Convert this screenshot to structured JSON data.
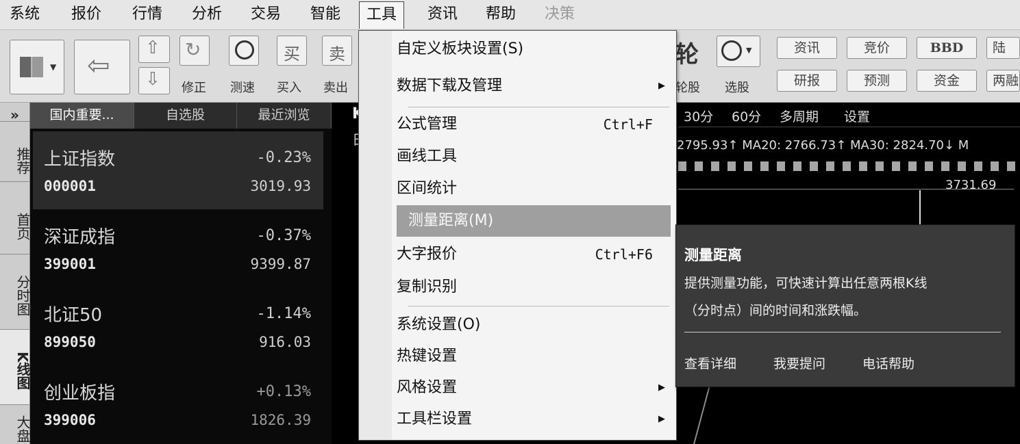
{
  "menubar": {
    "items": [
      {
        "label": "系统",
        "state": "normal"
      },
      {
        "label": "报价",
        "state": "normal"
      },
      {
        "label": "行情",
        "state": "normal"
      },
      {
        "label": "分析",
        "state": "normal"
      },
      {
        "label": "交易",
        "state": "normal"
      },
      {
        "label": "智能",
        "state": "normal"
      },
      {
        "label": "工具",
        "state": "active"
      },
      {
        "label": "资讯",
        "state": "normal"
      },
      {
        "label": "帮助",
        "state": "normal"
      },
      {
        "label": "决策",
        "state": "disabled"
      }
    ]
  },
  "toolbar": {
    "buttons": [
      {
        "label": "修正",
        "icon": "refresh-icon"
      },
      {
        "label": "测速",
        "icon": "clock-icon"
      },
      {
        "label": "买入",
        "icon_text": "买"
      },
      {
        "label": "卖出",
        "icon_text": "卖"
      },
      {
        "label": "轮股",
        "icon_text": "轮"
      },
      {
        "label": "选股",
        "icon": "select-stock-icon"
      }
    ],
    "pills_row1": [
      "资讯",
      "竞价",
      "BBD",
      "陆"
    ],
    "pills_row2": [
      "研报",
      "预测",
      "资金",
      "两融"
    ]
  },
  "left_strip": {
    "tabs": [
      "推荐",
      "首页",
      "分时图",
      "K线图",
      "大盘"
    ],
    "expand_glyph": "»"
  },
  "watchlist": {
    "tabs": [
      "国内重要...",
      "自选股",
      "最近浏览"
    ],
    "quotes": [
      {
        "name": "上证指数",
        "code": "000001",
        "change": "-0.23%",
        "price": "3019.93"
      },
      {
        "name": "深证成指",
        "code": "399001",
        "change": "-0.37%",
        "price": "9399.87"
      },
      {
        "name": "北证50",
        "code": "899050",
        "change": "-1.14%",
        "price": "916.03"
      },
      {
        "name": "创业板指",
        "code": "399006",
        "change": "+0.13%",
        "price": "1826.39"
      }
    ]
  },
  "chart": {
    "tab_letter": "K",
    "period_tabs": [
      "30分",
      "60分",
      "多周期",
      "设置"
    ],
    "ma_line": "2795.93↑ MA20: 2766.73↑ MA30: 2824.70↓ M",
    "peak_label": "3731.69",
    "left_fragment": "日"
  },
  "tools_menu": {
    "items": [
      {
        "label": "自定义板块设置(S)",
        "shortcut": "",
        "submenu": false
      },
      {
        "label": "数据下载及管理",
        "shortcut": "",
        "submenu": true
      },
      {
        "label": "公式管理",
        "shortcut": "Ctrl+F",
        "submenu": false
      },
      {
        "label": "画线工具",
        "shortcut": "",
        "submenu": false
      },
      {
        "label": "区间统计",
        "shortcut": "",
        "submenu": false
      },
      {
        "label": "测量距离(M)",
        "shortcut": "",
        "submenu": false,
        "highlighted": true
      },
      {
        "label": "大字报价",
        "shortcut": "Ctrl+F6",
        "submenu": false
      },
      {
        "label": "复制识别",
        "shortcut": "",
        "submenu": false
      },
      {
        "label": "系统设置(O)",
        "shortcut": "",
        "submenu": false
      },
      {
        "label": "热键设置",
        "shortcut": "",
        "submenu": false
      },
      {
        "label": "风格设置",
        "shortcut": "",
        "submenu": true
      },
      {
        "label": "工具栏设置",
        "shortcut": "",
        "submenu": true
      }
    ]
  },
  "tooltip": {
    "title": "测量距离",
    "desc_line1": "提供测量功能，可快速计算出任意两根K线",
    "desc_line2": "（分时点）间的时间和涨跌幅。",
    "links": [
      "查看详细",
      "我要提问",
      "电话帮助"
    ]
  },
  "colors": {
    "menubar_bg": "#e6e6e6",
    "panel_bg": "#0a0a0a",
    "menu_bg": "#f4f4f4",
    "menu_highlight": "#9f9f9f",
    "tooltip_bg": "#3a3a3a"
  }
}
